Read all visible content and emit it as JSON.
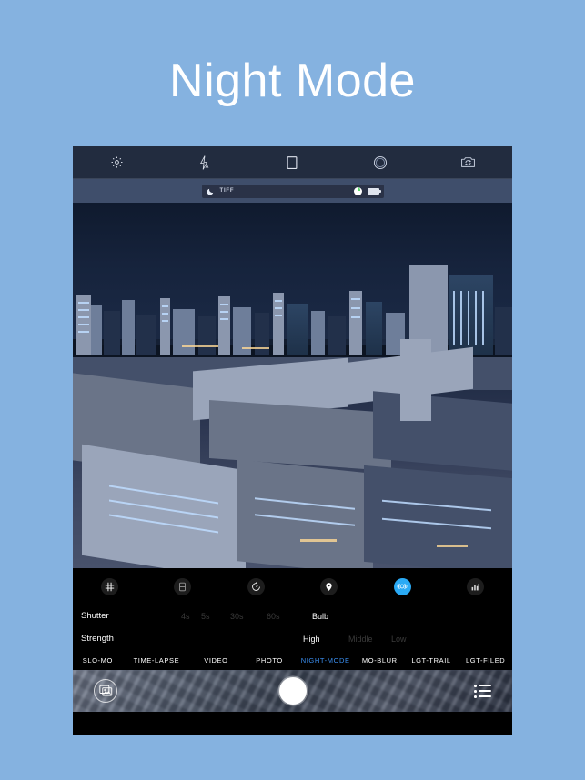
{
  "page": {
    "title": "Night Mode",
    "background_color": "#85b2e0",
    "title_color": "#ffffff"
  },
  "toolbar": {
    "items": [
      {
        "name": "settings",
        "icon": "gear-icon"
      },
      {
        "name": "flash",
        "icon": "flash-auto-icon"
      },
      {
        "name": "aspect-ratio",
        "icon": "rectangle-icon"
      },
      {
        "name": "aperture",
        "icon": "circle-aperture-icon"
      },
      {
        "name": "switch-camera",
        "icon": "camera-flip-icon"
      }
    ]
  },
  "info_strip": {
    "mode_icon": "moon-icon",
    "format": "TIFF",
    "indicator_icon": "white-dot-indicator",
    "battery_icon": "battery-icon"
  },
  "controls": {
    "items": [
      {
        "name": "grid",
        "icon": "grid-hash-icon",
        "active": false
      },
      {
        "name": "exposure",
        "icon": "exposure-icon",
        "active": false
      },
      {
        "name": "timer",
        "icon": "timer-icon",
        "active": false
      },
      {
        "name": "location",
        "icon": "location-pin-icon",
        "active": false
      },
      {
        "name": "stabilizer",
        "icon": "stabilizer-icon",
        "active": true
      },
      {
        "name": "histogram",
        "icon": "histogram-icon",
        "active": false
      }
    ],
    "accent_color": "#2aaaf5"
  },
  "settings_rows": [
    {
      "label": "Shutter",
      "options": [
        {
          "text": "4s",
          "selected": false
        },
        {
          "text": "5s",
          "selected": false
        },
        {
          "text": "30s",
          "selected": false
        },
        {
          "text": "60s",
          "selected": false
        },
        {
          "text": "Bulb",
          "selected": true
        }
      ]
    },
    {
      "label": "Strength",
      "options": [
        {
          "text": "High",
          "selected": true
        },
        {
          "text": "Middle",
          "selected": false
        },
        {
          "text": "Low",
          "selected": false
        }
      ]
    }
  ],
  "modes": {
    "selected_color": "#3a8ef0",
    "items": [
      {
        "label": "SLO-MO",
        "selected": false
      },
      {
        "label": "TIME-LAPSE",
        "selected": false
      },
      {
        "label": "VIDEO",
        "selected": false
      },
      {
        "label": "PHOTO",
        "selected": false
      },
      {
        "label": "NIGHT-MODE",
        "selected": true
      },
      {
        "label": "MO-BLUR",
        "selected": false
      },
      {
        "label": "LGT-TRAIL",
        "selected": false
      },
      {
        "label": "LGT-FILED",
        "selected": false
      }
    ]
  },
  "bottom_bar": {
    "gallery_icon": "gallery-photos-icon",
    "shutter_button": "shutter-button",
    "list_icon": "list-menu-icon"
  }
}
